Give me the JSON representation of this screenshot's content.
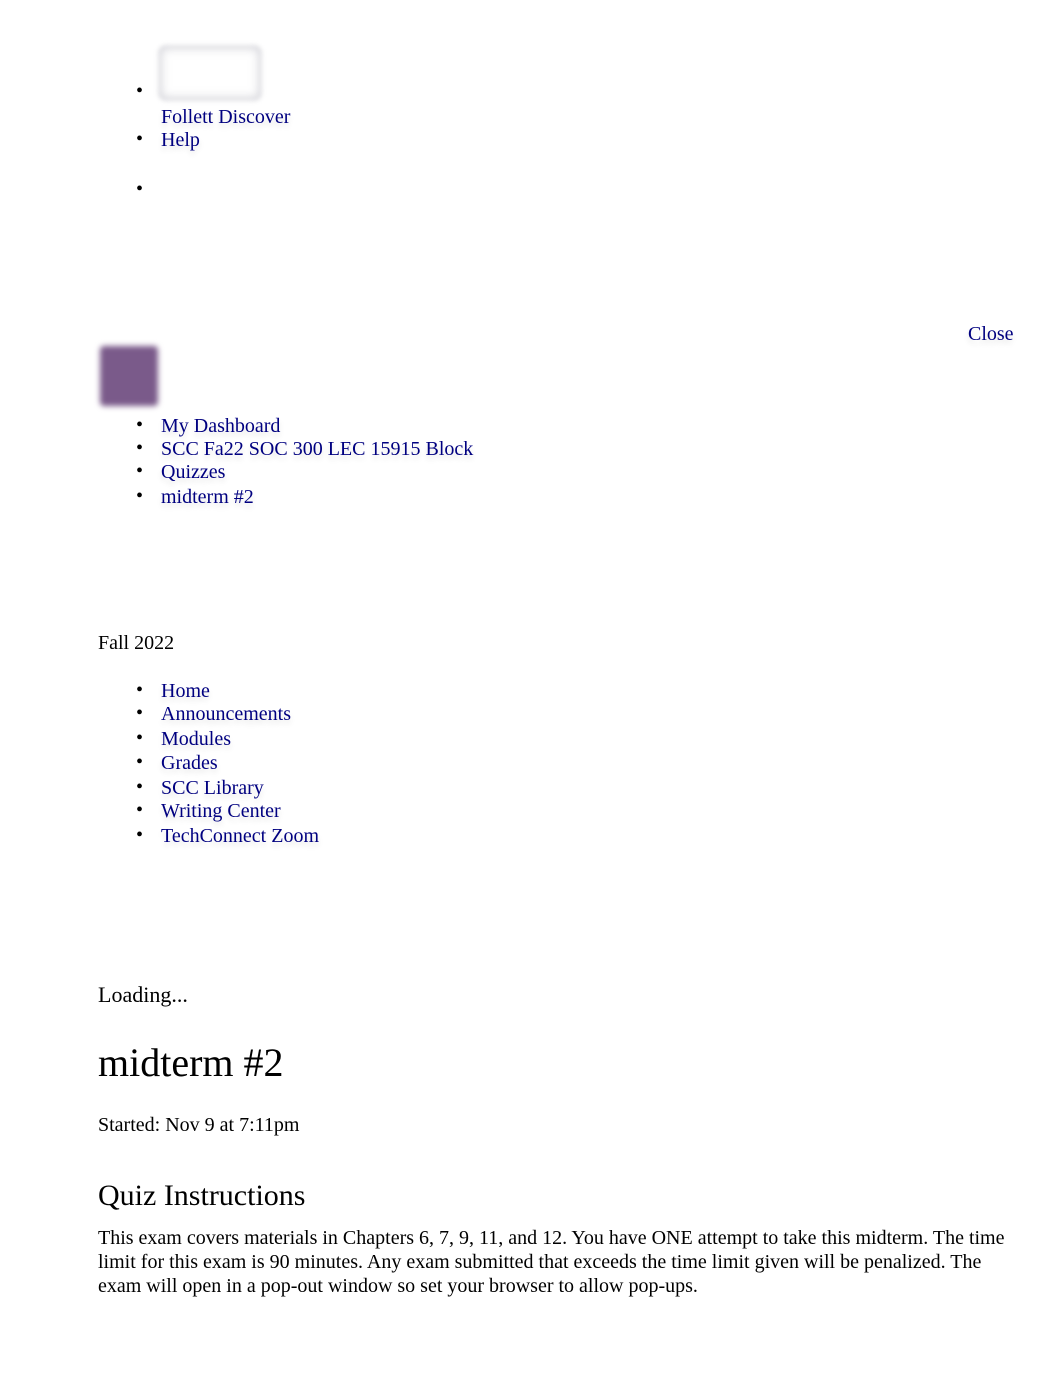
{
  "top_nav": {
    "items": [
      {
        "label": "Follett Discover"
      },
      {
        "label": "Help"
      },
      {
        "label": ""
      }
    ]
  },
  "close_label": "Close",
  "breadcrumb": [
    {
      "label": "My Dashboard"
    },
    {
      "label": "SCC Fa22 SOC 300 LEC 15915 Block"
    },
    {
      "label": "Quizzes"
    },
    {
      "label": "midterm #2"
    }
  ],
  "term": "Fall 2022",
  "course_nav": [
    {
      "label": "Home"
    },
    {
      "label": "Announcements"
    },
    {
      "label": "Modules"
    },
    {
      "label": "Grades"
    },
    {
      "label": "SCC Library"
    },
    {
      "label": "Writing Center"
    },
    {
      "label": "TechConnect Zoom"
    }
  ],
  "loading": "Loading...",
  "quiz": {
    "title": "midterm #2",
    "started": "Started: Nov 9 at 7:11pm",
    "instructions_heading": "Quiz Instructions",
    "instructions": "This exam covers materials in Chapters 6, 7, 9, 11, and 12. You have ONE attempt to take this midterm. The time limit for this exam is 90 minutes. Any exam submitted that exceeds the time limit given will be penalized. The exam will open in a pop-out window so set your browser to allow pop-ups."
  },
  "colors": {
    "link": "#000080"
  }
}
